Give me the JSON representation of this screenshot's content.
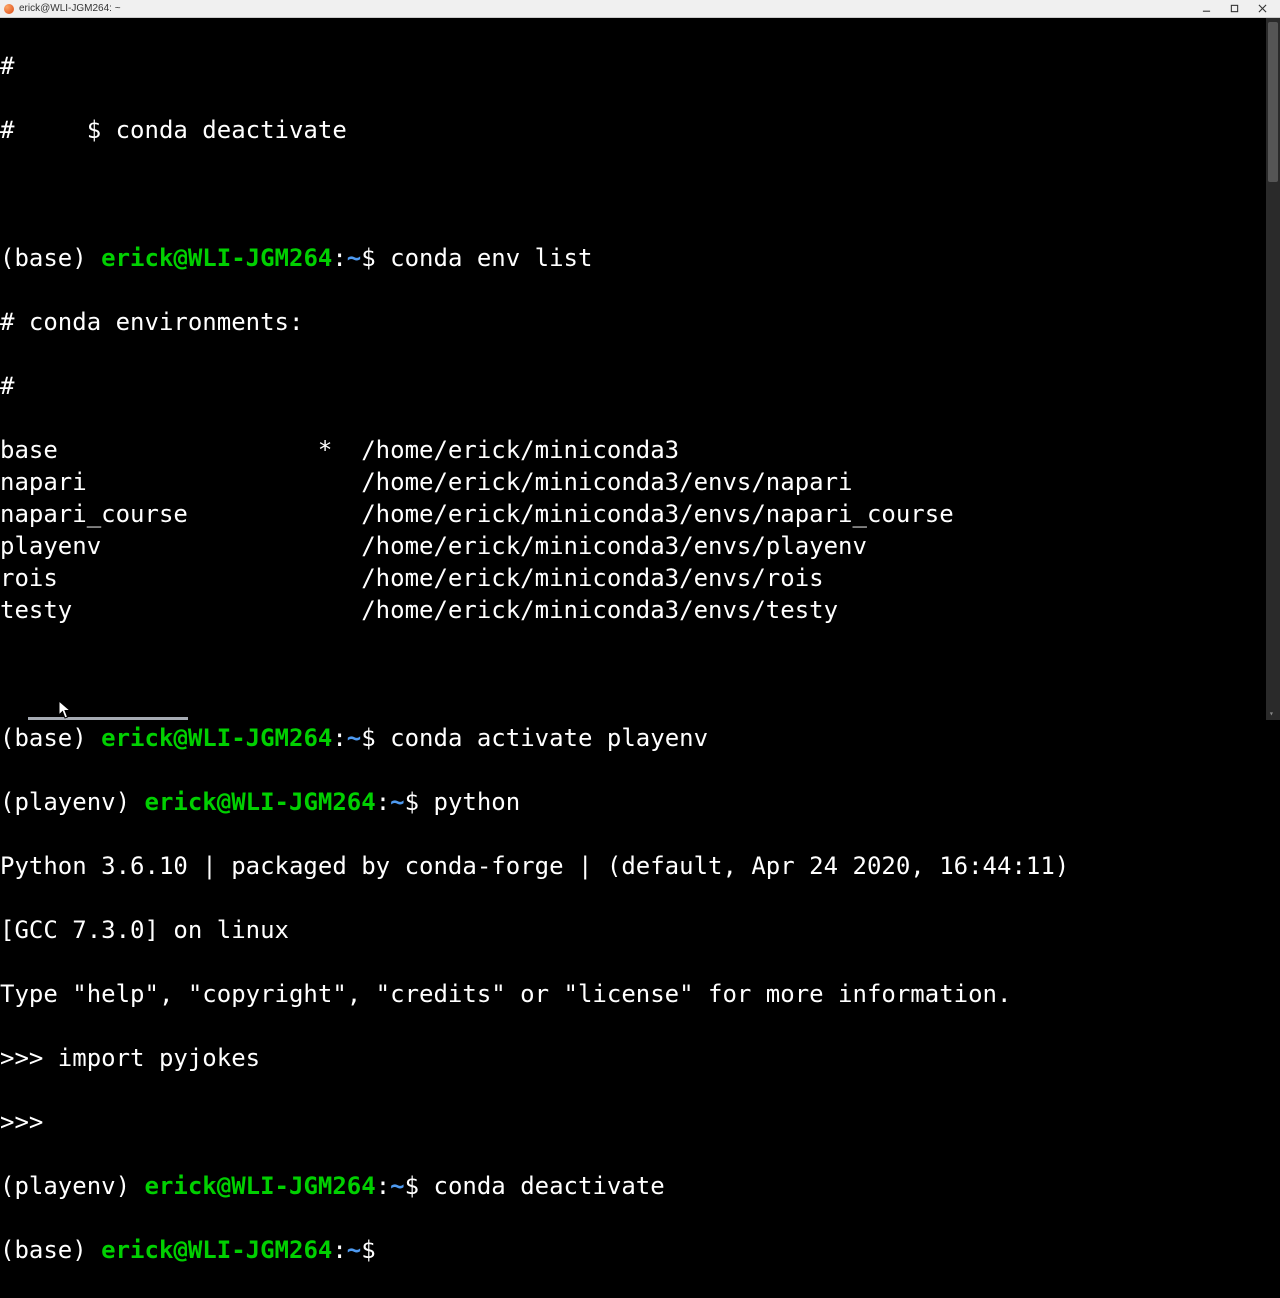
{
  "window": {
    "title": "erick@WLI-JGM264: ~"
  },
  "header": {
    "line1": "#",
    "line2": "#     $ conda deactivate"
  },
  "prompts": {
    "base_env": "(base) ",
    "playenv": "(playenv) ",
    "user_host": "erick@WLI-JGM264",
    "sep": ":",
    "cwd": "~",
    "dollar": "$ "
  },
  "cmds": {
    "env_list": "conda env list",
    "activate_playenv": "conda activate playenv",
    "python": "python",
    "deactivate": "conda deactivate"
  },
  "env_list": {
    "header": "# conda environments:",
    "hash": "#",
    "rows": [
      {
        "name": "base",
        "active": "*",
        "path": "/home/erick/miniconda3"
      },
      {
        "name": "napari",
        "active": " ",
        "path": "/home/erick/miniconda3/envs/napari"
      },
      {
        "name": "napari_course",
        "active": " ",
        "path": "/home/erick/miniconda3/envs/napari_course"
      },
      {
        "name": "playenv",
        "active": " ",
        "path": "/home/erick/miniconda3/envs/playenv"
      },
      {
        "name": "rois",
        "active": " ",
        "path": "/home/erick/miniconda3/envs/rois"
      },
      {
        "name": "testy",
        "active": " ",
        "path": "/home/erick/miniconda3/envs/testy"
      }
    ]
  },
  "python": {
    "banner1": "Python 3.6.10 | packaged by conda-forge | (default, Apr 24 2020, 16:44:11) ",
    "banner2": "[GCC 7.3.0] on linux",
    "banner3": "Type \"help\", \"copyright\", \"credits\" or \"license\" for more information.",
    "repl_prompt": ">>> ",
    "stmt1": "import pyjokes",
    "repl_prompt2": ">>> "
  }
}
